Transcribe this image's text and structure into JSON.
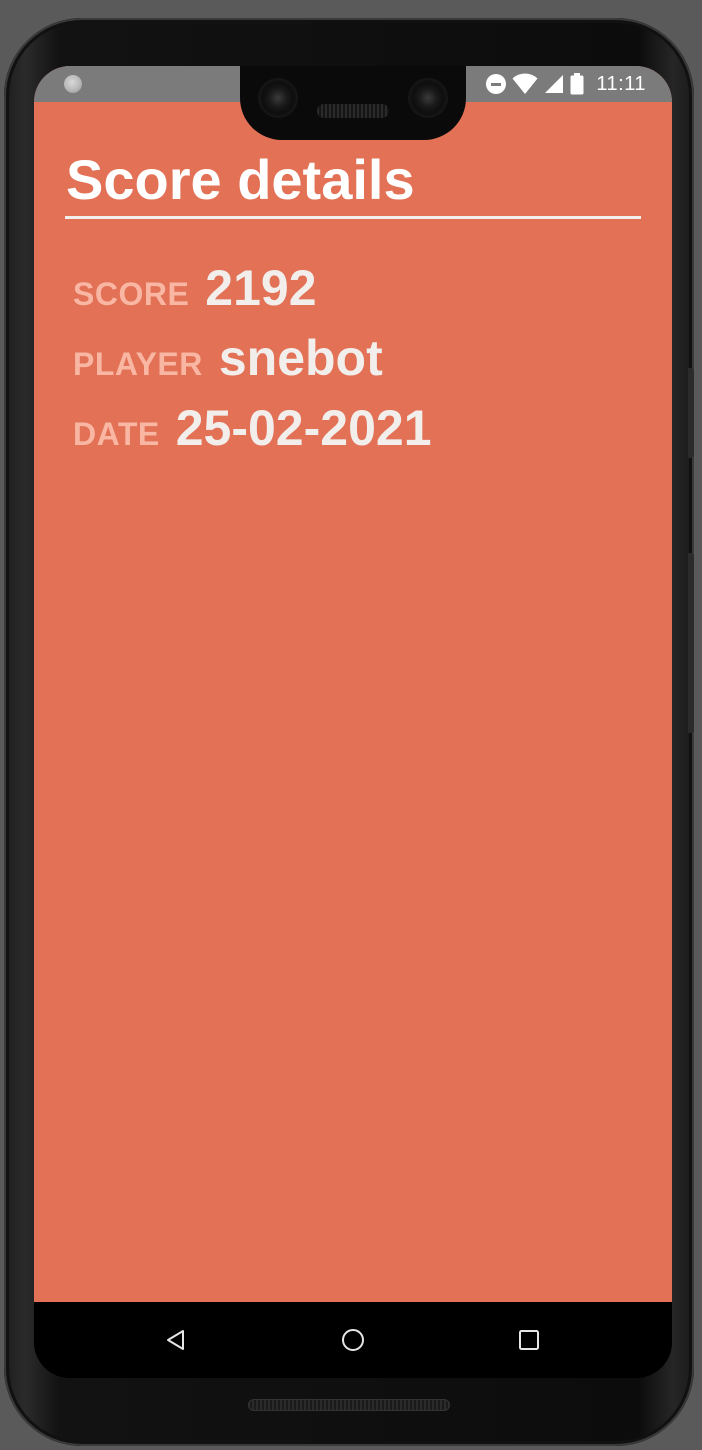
{
  "status_bar": {
    "time": "11:11",
    "icons": [
      "notification-dot-icon",
      "do-not-disturb-icon",
      "wifi-icon",
      "cellular-signal-icon",
      "battery-icon"
    ]
  },
  "page": {
    "title": "Score details",
    "accent_color": "#e27156"
  },
  "details": {
    "score_label": "SCORE",
    "score_value": "2192",
    "player_label": "PLAYER",
    "player_value": "snebot",
    "date_label": "DATE",
    "date_value": "25-02-2021"
  },
  "nav_bar": {
    "icons": [
      "back-icon",
      "home-icon",
      "recents-icon"
    ]
  }
}
